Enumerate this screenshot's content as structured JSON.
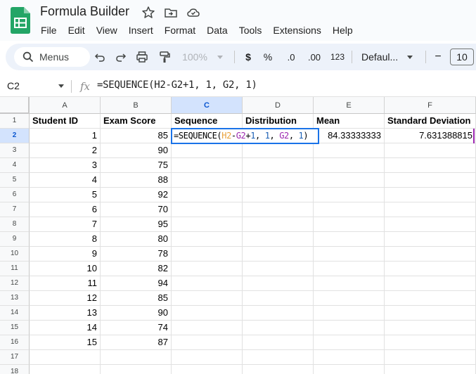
{
  "app": {
    "title": "Formula Builder",
    "menu": [
      "File",
      "Edit",
      "View",
      "Insert",
      "Format",
      "Data",
      "Tools",
      "Extensions",
      "Help"
    ]
  },
  "toolbar": {
    "menus_label": "Menus",
    "zoom": "100%",
    "currency": "$",
    "percent": "%",
    "decrease_decimal": ".0",
    "increase_decimal": ".00",
    "number_format": "123",
    "font": "Defaul...",
    "font_size_minus": "−",
    "font_size": "10"
  },
  "formula_bar": {
    "name_box": "C2",
    "fx": "fx",
    "formula": "=SEQUENCE(H2-G2+1, 1, G2, 1)"
  },
  "grid": {
    "columns": [
      "A",
      "B",
      "C",
      "D",
      "E",
      "F"
    ],
    "active_column": "C",
    "active_row": "2",
    "rows": [
      "1",
      "2",
      "3",
      "4",
      "5",
      "6",
      "7",
      "8",
      "9",
      "10",
      "11",
      "12",
      "13",
      "14",
      "15",
      "16",
      "17",
      "18"
    ],
    "headers": [
      "Student ID",
      "Exam Score",
      "Sequence",
      "Distribution",
      "Mean",
      "Standard Deviation"
    ],
    "data": [
      {
        "id": "1",
        "score": "85"
      },
      {
        "id": "2",
        "score": "90"
      },
      {
        "id": "3",
        "score": "75"
      },
      {
        "id": "4",
        "score": "88"
      },
      {
        "id": "5",
        "score": "92"
      },
      {
        "id": "6",
        "score": "70"
      },
      {
        "id": "7",
        "score": "95"
      },
      {
        "id": "8",
        "score": "80"
      },
      {
        "id": "9",
        "score": "78"
      },
      {
        "id": "10",
        "score": "82"
      },
      {
        "id": "11",
        "score": "94"
      },
      {
        "id": "12",
        "score": "85"
      },
      {
        "id": "13",
        "score": "90"
      },
      {
        "id": "14",
        "score": "74"
      },
      {
        "id": "15",
        "score": "87"
      }
    ],
    "mean_value": "84.33333333",
    "stdev_value": "7.631388815",
    "editor": {
      "fn": "=SEQUENCE(",
      "ref_h2": "H2",
      "minus": "-",
      "ref_g2a": "G2",
      "plus": "+",
      "num1": "1",
      "comma1": ", ",
      "num2": "1",
      "comma2": ", ",
      "ref_g2b": "G2",
      "comma3": ", ",
      "num3": "1",
      "close": ")"
    }
  },
  "colors": {
    "accent": "#1a73e8",
    "header_active": "#d3e3fd",
    "ref_h2": "#e8a13a",
    "ref_g2": "#9c27b0",
    "number": "#1a5fb4"
  }
}
